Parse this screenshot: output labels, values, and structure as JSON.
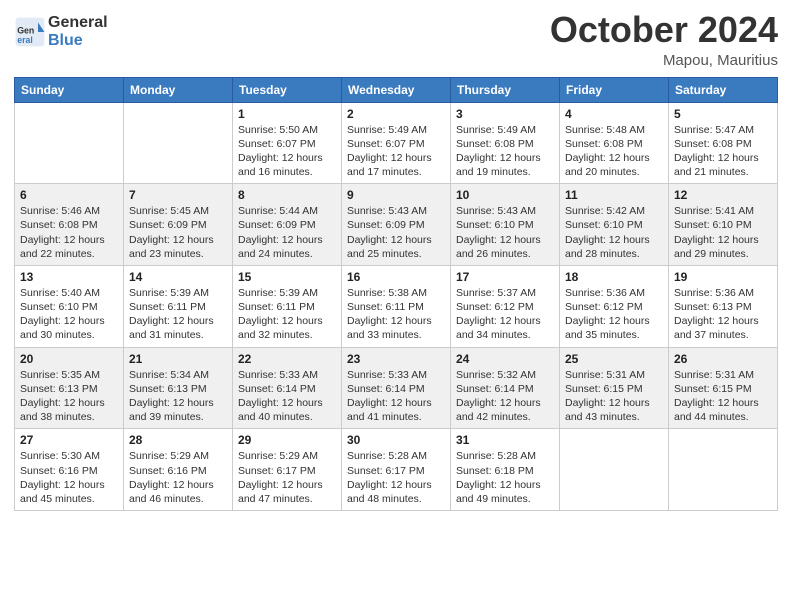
{
  "header": {
    "logo_line1": "General",
    "logo_line2": "Blue",
    "month": "October 2024",
    "location": "Mapou, Mauritius"
  },
  "days_of_week": [
    "Sunday",
    "Monday",
    "Tuesday",
    "Wednesday",
    "Thursday",
    "Friday",
    "Saturday"
  ],
  "weeks": [
    [
      {
        "day": "",
        "info": ""
      },
      {
        "day": "",
        "info": ""
      },
      {
        "day": "1",
        "sunrise": "5:50 AM",
        "sunset": "6:07 PM",
        "daylight": "12 hours and 16 minutes."
      },
      {
        "day": "2",
        "sunrise": "5:49 AM",
        "sunset": "6:07 PM",
        "daylight": "12 hours and 17 minutes."
      },
      {
        "day": "3",
        "sunrise": "5:49 AM",
        "sunset": "6:08 PM",
        "daylight": "12 hours and 19 minutes."
      },
      {
        "day": "4",
        "sunrise": "5:48 AM",
        "sunset": "6:08 PM",
        "daylight": "12 hours and 20 minutes."
      },
      {
        "day": "5",
        "sunrise": "5:47 AM",
        "sunset": "6:08 PM",
        "daylight": "12 hours and 21 minutes."
      }
    ],
    [
      {
        "day": "6",
        "sunrise": "5:46 AM",
        "sunset": "6:08 PM",
        "daylight": "12 hours and 22 minutes."
      },
      {
        "day": "7",
        "sunrise": "5:45 AM",
        "sunset": "6:09 PM",
        "daylight": "12 hours and 23 minutes."
      },
      {
        "day": "8",
        "sunrise": "5:44 AM",
        "sunset": "6:09 PM",
        "daylight": "12 hours and 24 minutes."
      },
      {
        "day": "9",
        "sunrise": "5:43 AM",
        "sunset": "6:09 PM",
        "daylight": "12 hours and 25 minutes."
      },
      {
        "day": "10",
        "sunrise": "5:43 AM",
        "sunset": "6:10 PM",
        "daylight": "12 hours and 26 minutes."
      },
      {
        "day": "11",
        "sunrise": "5:42 AM",
        "sunset": "6:10 PM",
        "daylight": "12 hours and 28 minutes."
      },
      {
        "day": "12",
        "sunrise": "5:41 AM",
        "sunset": "6:10 PM",
        "daylight": "12 hours and 29 minutes."
      }
    ],
    [
      {
        "day": "13",
        "sunrise": "5:40 AM",
        "sunset": "6:10 PM",
        "daylight": "12 hours and 30 minutes."
      },
      {
        "day": "14",
        "sunrise": "5:39 AM",
        "sunset": "6:11 PM",
        "daylight": "12 hours and 31 minutes."
      },
      {
        "day": "15",
        "sunrise": "5:39 AM",
        "sunset": "6:11 PM",
        "daylight": "12 hours and 32 minutes."
      },
      {
        "day": "16",
        "sunrise": "5:38 AM",
        "sunset": "6:11 PM",
        "daylight": "12 hours and 33 minutes."
      },
      {
        "day": "17",
        "sunrise": "5:37 AM",
        "sunset": "6:12 PM",
        "daylight": "12 hours and 34 minutes."
      },
      {
        "day": "18",
        "sunrise": "5:36 AM",
        "sunset": "6:12 PM",
        "daylight": "12 hours and 35 minutes."
      },
      {
        "day": "19",
        "sunrise": "5:36 AM",
        "sunset": "6:13 PM",
        "daylight": "12 hours and 37 minutes."
      }
    ],
    [
      {
        "day": "20",
        "sunrise": "5:35 AM",
        "sunset": "6:13 PM",
        "daylight": "12 hours and 38 minutes."
      },
      {
        "day": "21",
        "sunrise": "5:34 AM",
        "sunset": "6:13 PM",
        "daylight": "12 hours and 39 minutes."
      },
      {
        "day": "22",
        "sunrise": "5:33 AM",
        "sunset": "6:14 PM",
        "daylight": "12 hours and 40 minutes."
      },
      {
        "day": "23",
        "sunrise": "5:33 AM",
        "sunset": "6:14 PM",
        "daylight": "12 hours and 41 minutes."
      },
      {
        "day": "24",
        "sunrise": "5:32 AM",
        "sunset": "6:14 PM",
        "daylight": "12 hours and 42 minutes."
      },
      {
        "day": "25",
        "sunrise": "5:31 AM",
        "sunset": "6:15 PM",
        "daylight": "12 hours and 43 minutes."
      },
      {
        "day": "26",
        "sunrise": "5:31 AM",
        "sunset": "6:15 PM",
        "daylight": "12 hours and 44 minutes."
      }
    ],
    [
      {
        "day": "27",
        "sunrise": "5:30 AM",
        "sunset": "6:16 PM",
        "daylight": "12 hours and 45 minutes."
      },
      {
        "day": "28",
        "sunrise": "5:29 AM",
        "sunset": "6:16 PM",
        "daylight": "12 hours and 46 minutes."
      },
      {
        "day": "29",
        "sunrise": "5:29 AM",
        "sunset": "6:17 PM",
        "daylight": "12 hours and 47 minutes."
      },
      {
        "day": "30",
        "sunrise": "5:28 AM",
        "sunset": "6:17 PM",
        "daylight": "12 hours and 48 minutes."
      },
      {
        "day": "31",
        "sunrise": "5:28 AM",
        "sunset": "6:18 PM",
        "daylight": "12 hours and 49 minutes."
      },
      {
        "day": "",
        "info": ""
      },
      {
        "day": "",
        "info": ""
      }
    ]
  ]
}
